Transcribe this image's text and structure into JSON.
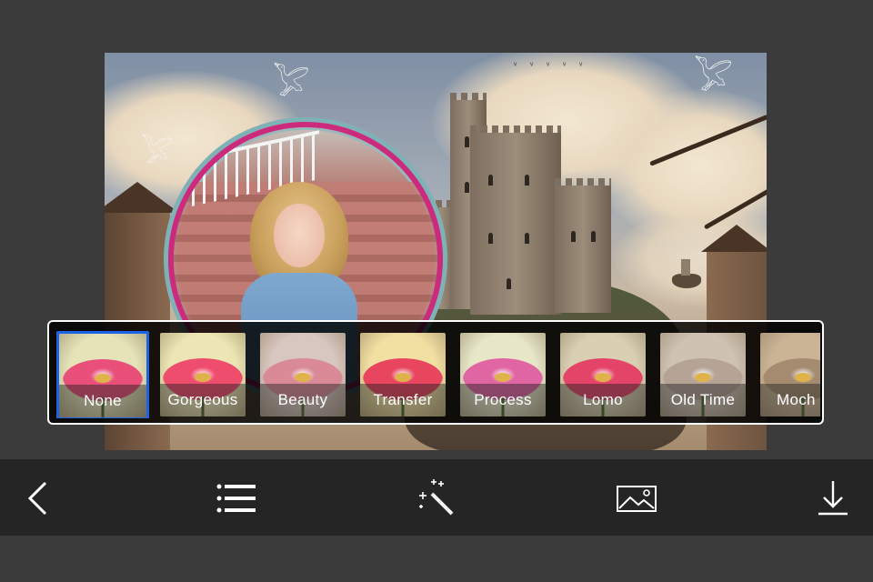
{
  "filters": {
    "selected_index": 0,
    "items": [
      {
        "label": "None",
        "tint": "#e5e3b8",
        "petal": "#e8507a"
      },
      {
        "label": "Gorgeous",
        "tint": "#ece6b4",
        "petal": "#ef4d6e"
      },
      {
        "label": "Beauty",
        "tint": "#d8c6c0",
        "petal": "#d98a96"
      },
      {
        "label": "Transfer",
        "tint": "#f1e0a2",
        "petal": "#e8455f"
      },
      {
        "label": "Process",
        "tint": "#e7e6c8",
        "petal": "#e065a3"
      },
      {
        "label": "Lomo",
        "tint": "#d9cfb2",
        "petal": "#e44468"
      },
      {
        "label": "Old Time",
        "tint": "#cfc2b3",
        "petal": "#b5a395"
      },
      {
        "label": "Moch",
        "tint": "#cbb396",
        "petal": "#a58c70"
      }
    ]
  },
  "toolbar": {
    "back": "back-icon",
    "menu": "list-icon",
    "effects": "magic-wand-icon",
    "gallery": "image-icon",
    "save": "download-icon"
  },
  "colors": {
    "selection": "#1e63e6",
    "frame_ring": "#cc2a7c",
    "toolbar_bg": "#252525",
    "page_bg": "#3b3b3b"
  }
}
